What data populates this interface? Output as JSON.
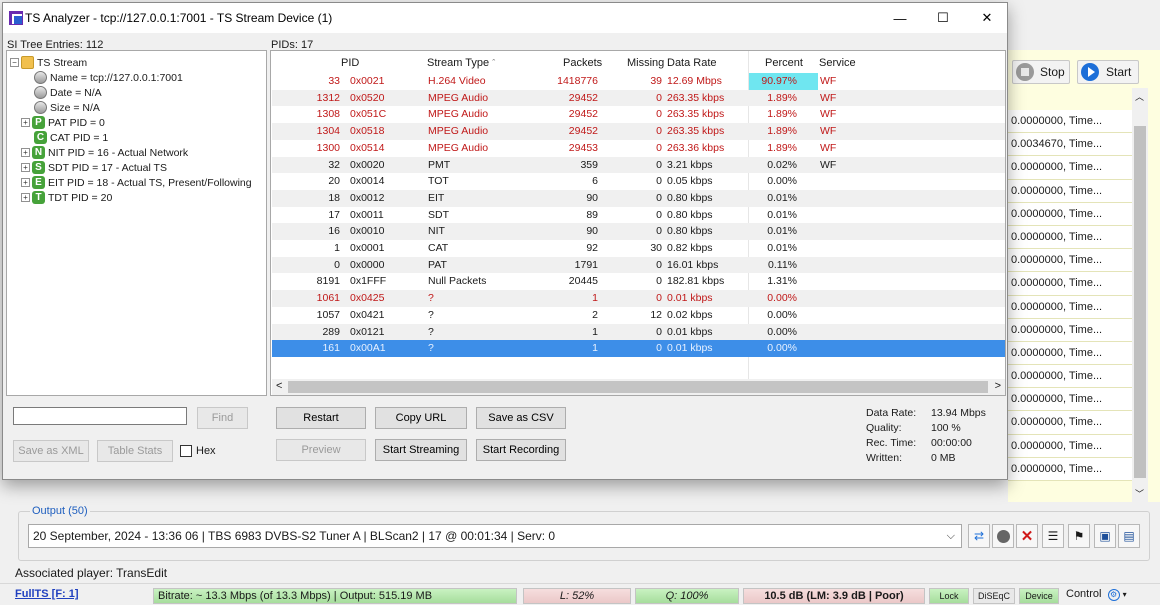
{
  "dialog": {
    "title": "TS Analyzer - tcp://127.0.0.1:7001 - TS Stream Device (1)",
    "minimize": "—",
    "maximize": "☐",
    "close": "✕"
  },
  "tree": {
    "header": "SI Tree Entries: 112",
    "items": [
      {
        "label": "TS Stream",
        "icon": "folder-icon",
        "expander": "−"
      },
      {
        "label": "Name = tcp://127.0.0.1:7001",
        "icon": "info-icon"
      },
      {
        "label": "Date = N/A",
        "icon": "info-icon"
      },
      {
        "label": "Size = N/A",
        "icon": "info-icon"
      },
      {
        "label": "PAT PID = 0",
        "icon": "pat-icon",
        "letter": "P",
        "expander": "+"
      },
      {
        "label": "CAT PID = 1",
        "icon": "cat-icon",
        "letter": "C"
      },
      {
        "label": "NIT PID = 16 - Actual Network",
        "icon": "nit-icon",
        "letter": "N",
        "expander": "+"
      },
      {
        "label": "SDT PID = 17 - Actual TS",
        "icon": "sdt-icon",
        "letter": "S",
        "expander": "+"
      },
      {
        "label": "EIT PID = 18 - Actual TS, Present/Following",
        "icon": "eit-icon",
        "letter": "E",
        "expander": "+"
      },
      {
        "label": "TDT PID = 20",
        "icon": "tdt-icon",
        "letter": "T",
        "expander": "+"
      }
    ]
  },
  "table": {
    "header": "PIDs: 17",
    "columns": [
      "PID",
      "Stream Type",
      "Packets",
      "Missing",
      "Data Rate",
      "Percent",
      "Service"
    ],
    "sort_indicator": "ˆ",
    "rows": [
      {
        "pid_dec": "33",
        "pid_hex": "0x0021",
        "type": "H.264 Video",
        "packets": "1418776",
        "missing": "39",
        "rate": "12.69 Mbps",
        "percent": "90.97%",
        "service": "WF",
        "red": true
      },
      {
        "pid_dec": "1312",
        "pid_hex": "0x0520",
        "type": "MPEG Audio",
        "packets": "29452",
        "missing": "0",
        "rate": "263.35 kbps",
        "percent": "1.89%",
        "service": "WF",
        "red": true
      },
      {
        "pid_dec": "1308",
        "pid_hex": "0x051C",
        "type": "MPEG Audio",
        "packets": "29452",
        "missing": "0",
        "rate": "263.35 kbps",
        "percent": "1.89%",
        "service": "WF",
        "red": true
      },
      {
        "pid_dec": "1304",
        "pid_hex": "0x0518",
        "type": "MPEG Audio",
        "packets": "29452",
        "missing": "0",
        "rate": "263.35 kbps",
        "percent": "1.89%",
        "service": "WF",
        "red": true
      },
      {
        "pid_dec": "1300",
        "pid_hex": "0x0514",
        "type": "MPEG Audio",
        "packets": "29453",
        "missing": "0",
        "rate": "263.36 kbps",
        "percent": "1.89%",
        "service": "WF",
        "red": true
      },
      {
        "pid_dec": "32",
        "pid_hex": "0x0020",
        "type": "PMT",
        "packets": "359",
        "missing": "0",
        "rate": "3.21 kbps",
        "percent": "0.02%",
        "service": "WF",
        "red": false
      },
      {
        "pid_dec": "20",
        "pid_hex": "0x0014",
        "type": "TOT",
        "packets": "6",
        "missing": "0",
        "rate": "0.05 kbps",
        "percent": "0.00%",
        "service": "",
        "red": false
      },
      {
        "pid_dec": "18",
        "pid_hex": "0x0012",
        "type": "EIT",
        "packets": "90",
        "missing": "0",
        "rate": "0.80 kbps",
        "percent": "0.01%",
        "service": "",
        "red": false
      },
      {
        "pid_dec": "17",
        "pid_hex": "0x0011",
        "type": "SDT",
        "packets": "89",
        "missing": "0",
        "rate": "0.80 kbps",
        "percent": "0.01%",
        "service": "",
        "red": false
      },
      {
        "pid_dec": "16",
        "pid_hex": "0x0010",
        "type": "NIT",
        "packets": "90",
        "missing": "0",
        "rate": "0.80 kbps",
        "percent": "0.01%",
        "service": "",
        "red": false
      },
      {
        "pid_dec": "1",
        "pid_hex": "0x0001",
        "type": "CAT",
        "packets": "92",
        "missing": "30",
        "rate": "0.82 kbps",
        "percent": "0.01%",
        "service": "",
        "red": false
      },
      {
        "pid_dec": "0",
        "pid_hex": "0x0000",
        "type": "PAT",
        "packets": "1791",
        "missing": "0",
        "rate": "16.01 kbps",
        "percent": "0.11%",
        "service": "",
        "red": false
      },
      {
        "pid_dec": "8191",
        "pid_hex": "0x1FFF",
        "type": "Null Packets",
        "packets": "20445",
        "missing": "0",
        "rate": "182.81 kbps",
        "percent": "1.31%",
        "service": "",
        "red": false
      },
      {
        "pid_dec": "1061",
        "pid_hex": "0x0425",
        "type": "?",
        "packets": "1",
        "missing": "0",
        "rate": "0.01 kbps",
        "percent": "0.00%",
        "service": "",
        "red": true
      },
      {
        "pid_dec": "1057",
        "pid_hex": "0x0421",
        "type": "?",
        "packets": "2",
        "missing": "12",
        "rate": "0.02 kbps",
        "percent": "0.00%",
        "service": "",
        "red": false
      },
      {
        "pid_dec": "289",
        "pid_hex": "0x0121",
        "type": "?",
        "packets": "1",
        "missing": "0",
        "rate": "0.01 kbps",
        "percent": "0.00%",
        "service": "",
        "red": false
      },
      {
        "pid_dec": "161",
        "pid_hex": "0x00A1",
        "type": "?",
        "packets": "1",
        "missing": "0",
        "rate": "0.01 kbps",
        "percent": "0.00%",
        "service": "",
        "red": false,
        "selected": true
      }
    ],
    "scroll_left": "<",
    "scroll_right": ">"
  },
  "controls": {
    "find_placeholder": "",
    "find": "Find",
    "save_xml": "Save as XML",
    "table_stats": "Table Stats",
    "hex": "Hex",
    "restart": "Restart",
    "copy_url": "Copy URL",
    "save_csv": "Save as CSV",
    "preview": "Preview",
    "start_streaming": "Start Streaming",
    "start_recording": "Start Recording"
  },
  "info": {
    "data_rate_label": "Data Rate:",
    "data_rate": "13.94 Mbps",
    "quality_label": "Quality:",
    "quality": "100 %",
    "rec_time_label": "Rec. Time:",
    "rec_time": "00:00:00",
    "written_label": "Written:",
    "written": "0 MB"
  },
  "main": {
    "stop": "Stop",
    "start": "Start",
    "list_items": [
      "0.0000000, Time...",
      "0.0034670, Time...",
      "0.0000000, Time...",
      "0.0000000, Time...",
      "0.0000000, Time...",
      "0.0000000, Time...",
      "0.0000000, Time...",
      "0.0000000, Time...",
      "0.0000000, Time...",
      "0.0000000, Time...",
      "0.0000000, Time...",
      "0.0000000, Time...",
      "0.0000000, Time...",
      "0.0000000, Time...",
      "0.0000000, Time...",
      "0.0000000, Time..."
    ],
    "output_label": "Output (50)",
    "output_value": "20 September, 2024 - 13:36 06 | TBS 6983 DVBS-S2 Tuner A | BLScan2 | 17 @ 00:01:34 | Serv: 0",
    "associated_player": "Associated player: TransEdit"
  },
  "statusbar": {
    "fullts": "FullTS [F: 1]",
    "bitrate": "Bitrate: ~ 13.3 Mbps (of 13.3 Mbps) | Output: 515.19 MB",
    "level": "L: 52%",
    "quality": "Q: 100%",
    "snr": "10.5 dB (LM: 3.9 dB | Poor)",
    "lock": "Lock",
    "diseqc": "DiSEqC",
    "device": "Device",
    "control": "Control"
  },
  "colors": {
    "accent": "#3d8ee8",
    "percent_highlight": "#6fe6f0",
    "red_text": "#c01818",
    "stripe": "#f0f0f0"
  }
}
